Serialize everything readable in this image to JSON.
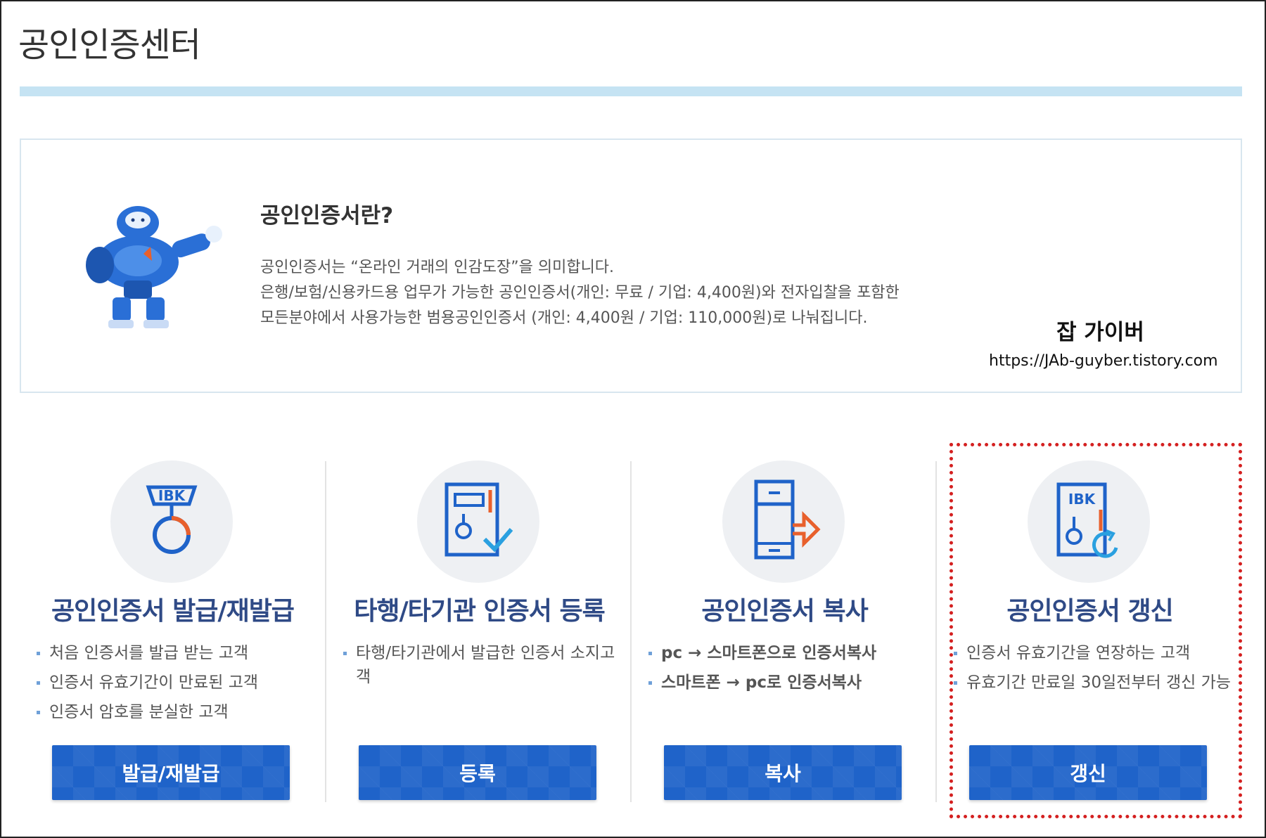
{
  "page": {
    "title": "공인인증센터"
  },
  "intro": {
    "heading": "공인인증서란?",
    "lines": [
      "공인인증서는 “온라인 거래의 인감도장”을 의미합니다.",
      "은행/보험/신용카드용 업무가 가능한 공인인증서(개인: 무료 / 기업: 4,400원)와 전자입찰을 포함한",
      "모든분야에서 사용가능한 범용공인인증서 (개인: 4,400원 / 기업: 110,000원)로 나눠집니다."
    ]
  },
  "watermark": {
    "title": "잡 가이버",
    "url": "https://JAb-guyber.tistory.com"
  },
  "cards": [
    {
      "icon": "ibk-medal-icon",
      "icon_label": "IBK",
      "title": "공인인증서 발급/재발급",
      "bullets": [
        "처음 인증서를 발급 받는 고객",
        "인증서 유효기간이 만료된 고객",
        "인증서 암호를 분실한 고객"
      ],
      "button": "발급/재발급"
    },
    {
      "icon": "certificate-check-icon",
      "title": "타행/타기관 인증서 등록",
      "bullets": [
        "타행/타기관에서 발급한 인증서 소지고객"
      ],
      "button": "등록"
    },
    {
      "icon": "phone-transfer-icon",
      "title": "공인인증서 복사",
      "bullets": [
        "pc → 스마트폰으로 인증서복사",
        "스마트폰 → pc로 인증서복사"
      ],
      "button": "복사"
    },
    {
      "icon": "ibk-renew-icon",
      "icon_label": "IBK",
      "title": "공인인증서 갱신",
      "bullets": [
        "인증서 유효기간을 연장하는 고객",
        "유효기간 만료일 30일전부터 갱신 가능"
      ],
      "button": "갱신"
    }
  ],
  "colors": {
    "accent_bar": "#c5e3f3",
    "title_blue": "#2f4a86",
    "button_blue": "#1f63c9",
    "icon_orange": "#e8602c",
    "highlight_red": "#d42020"
  }
}
